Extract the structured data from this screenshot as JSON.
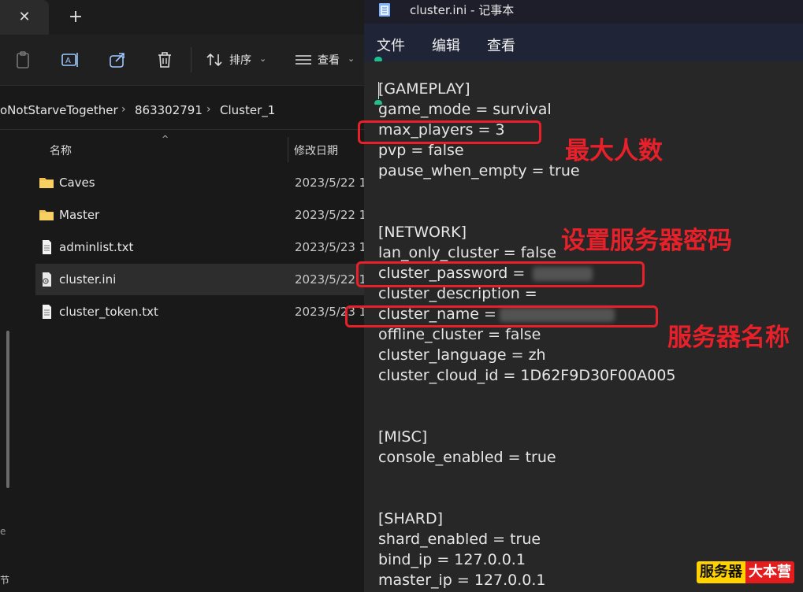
{
  "explorer": {
    "tab_close": "✕",
    "tab_new": "+",
    "toolbar": {
      "sort_label": "排序",
      "view_label": "查看",
      "chevron": "⌄"
    },
    "breadcrumb": [
      "oNotStarveTogether",
      "863302791",
      "Cluster_1"
    ],
    "breadcrumb_sep": "›",
    "columns": {
      "name": "名称",
      "date": "修改日期",
      "sort_arrow": "^"
    },
    "files": [
      {
        "name": "Caves",
        "date": "2023/5/22 1",
        "type": "folder"
      },
      {
        "name": "Master",
        "date": "2023/5/22 1",
        "type": "folder"
      },
      {
        "name": "adminlist.txt",
        "date": "2023/5/23 1",
        "type": "text"
      },
      {
        "name": "cluster.ini",
        "date": "2023/5/22 1",
        "type": "ini",
        "selected": true
      },
      {
        "name": "cluster_token.txt",
        "date": "2023/5/23 1",
        "type": "text"
      }
    ],
    "nav_fragment_1": "e",
    "nav_fragment_2": "节"
  },
  "notepad": {
    "title": "cluster.ini - 记事本",
    "menu": [
      "文件",
      "编辑",
      "查看"
    ],
    "lines": [
      "[GAMEPLAY]",
      "game_mode = survival",
      "max_players = 3",
      "pvp = false",
      "pause_when_empty = true",
      "",
      "",
      "[NETWORK]",
      "lan_only_cluster = false",
      "cluster_password = ",
      "cluster_description = ",
      "cluster_name = ",
      "offline_cluster = false",
      "cluster_language = zh",
      "cluster_cloud_id = 1D62F9D30F00A005",
      "",
      "",
      "[MISC]",
      "console_enabled = true",
      "",
      "",
      "[SHARD]",
      "shard_enabled = true",
      "bind_ip = 127.0.0.1",
      "master_ip = 127.0.0.1"
    ]
  },
  "annotations": {
    "max_players": "最大人数",
    "password": "设置服务器密码",
    "server_name": "服务器名称",
    "color": "#e8202a"
  },
  "watermark": {
    "left": "服务器",
    "right": "大本营"
  }
}
